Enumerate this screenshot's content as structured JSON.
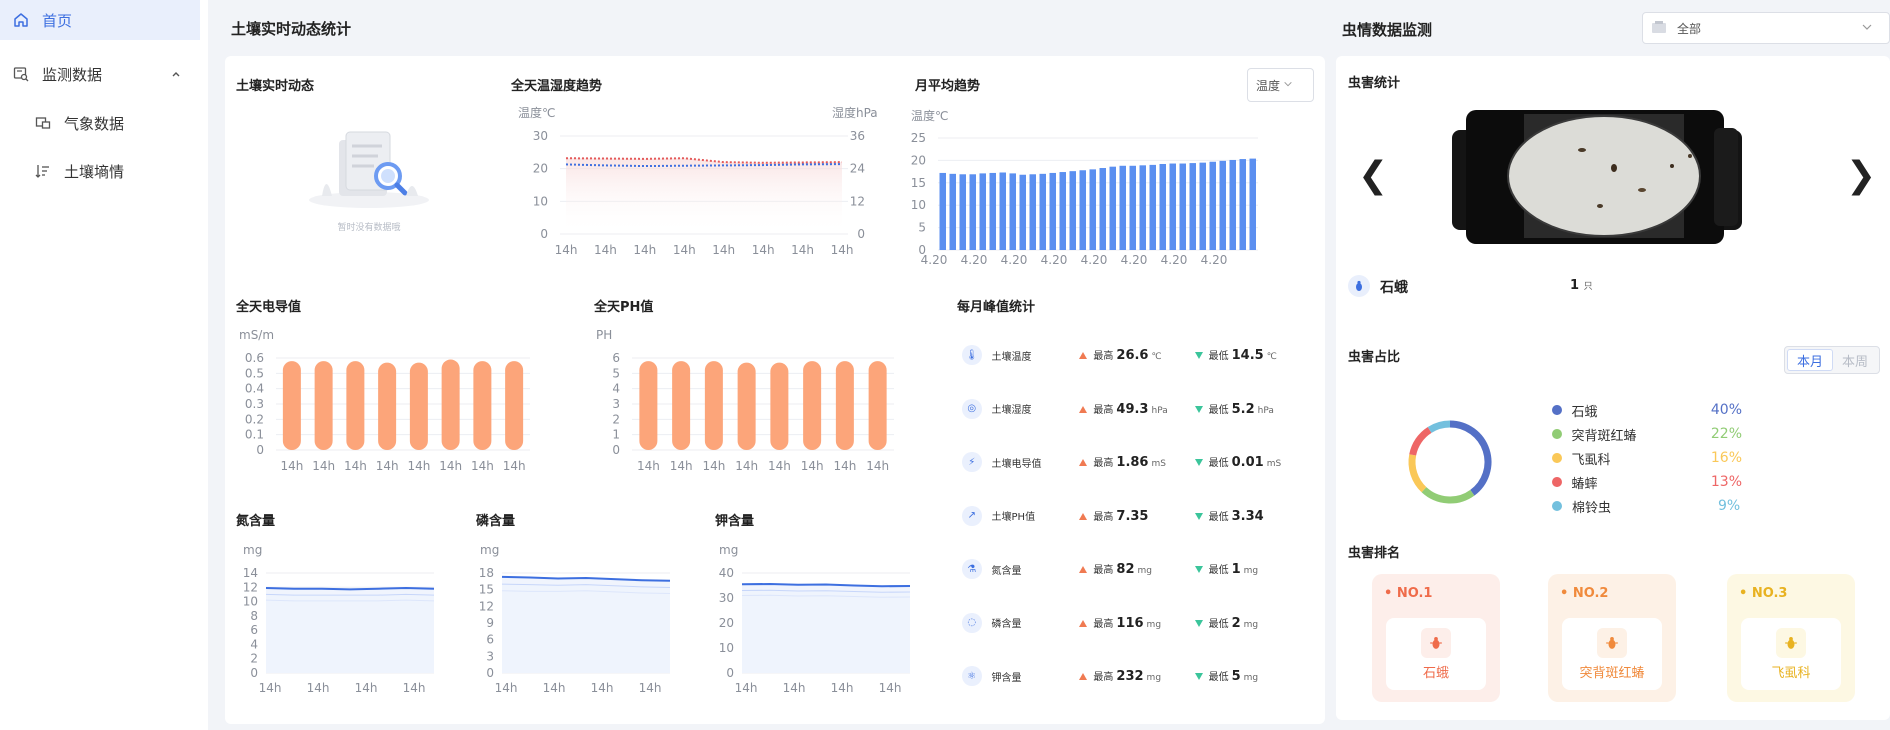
{
  "sidebar": {
    "items": [
      {
        "label": "首页"
      },
      {
        "label": "监测数据"
      },
      {
        "label": "气象数据"
      },
      {
        "label": "土壤墒情"
      }
    ]
  },
  "soil": {
    "title": "土壤实时动态统计",
    "realtime": {
      "title": "土壤实时动态",
      "empty": "暂时没有数据哦"
    },
    "temp_hum": {
      "title": "全天温湿度趋势",
      "ylabel_left": "温度℃",
      "ylabel_right": "湿度hPa"
    },
    "monthly": {
      "title": "月平均趋势",
      "select": "温度",
      "ylabel": "温度℃"
    },
    "ec": {
      "title": "全天电导值",
      "ylabel": "mS/m"
    },
    "ph": {
      "title": "全天PH值",
      "ylabel": "PH"
    },
    "n": {
      "title": "氮含量",
      "ylabel": "mg"
    },
    "p": {
      "title": "磷含量",
      "ylabel": "mg"
    },
    "k": {
      "title": "钾含量",
      "ylabel": "mg"
    },
    "peak": {
      "title": "每月峰值统计",
      "hi_label": "最高",
      "lo_label": "最低",
      "rows": [
        {
          "name": "土壤温度",
          "hi": "26.6",
          "hi_unit": "℃",
          "lo": "14.5",
          "lo_unit": "℃",
          "icon": "thermometer-icon"
        },
        {
          "name": "土壤湿度",
          "hi": "49.3",
          "hi_unit": "hPa",
          "lo": "5.2",
          "lo_unit": "hPa",
          "icon": "humidity-icon"
        },
        {
          "name": "土壤电导值",
          "hi": "1.86",
          "hi_unit": "mS",
          "lo": "0.01",
          "lo_unit": "mS",
          "icon": "lightning-icon"
        },
        {
          "name": "土壤PH值",
          "hi": "7.35",
          "hi_unit": "",
          "lo": "3.34",
          "lo_unit": "",
          "icon": "line-chart-icon"
        },
        {
          "name": "氮含量",
          "hi": "82",
          "hi_unit": "mg",
          "lo": "1",
          "lo_unit": "mg",
          "icon": "flask-icon"
        },
        {
          "name": "磷含量",
          "hi": "116",
          "hi_unit": "mg",
          "lo": "2",
          "lo_unit": "mg",
          "icon": "drop-icon"
        },
        {
          "name": "钾含量",
          "hi": "232",
          "hi_unit": "mg",
          "lo": "5",
          "lo_unit": "mg",
          "icon": "molecule-icon"
        }
      ]
    }
  },
  "pest": {
    "title": "虫情数据监测",
    "select": "全部",
    "stats": {
      "title": "虫害统计",
      "name": "石蛾",
      "count": "1",
      "count_unit": "只"
    },
    "ratio": {
      "title": "虫害占比",
      "toggle": [
        "本月",
        "本周"
      ],
      "items": [
        {
          "name": "石蛾",
          "pct": "40%",
          "color": "#5470c6"
        },
        {
          "name": "突背斑红蝽",
          "pct": "22%",
          "color": "#91cc75"
        },
        {
          "name": "飞虱科",
          "pct": "16%",
          "color": "#fac858"
        },
        {
          "name": "蝽蟀",
          "pct": "13%",
          "color": "#ee6666"
        },
        {
          "name": "棉铃虫",
          "pct": "9%",
          "color": "#73c0de"
        }
      ]
    },
    "rank": {
      "title": "虫害排名",
      "items": [
        {
          "no": "NO.1",
          "name": "石蛾",
          "bg": "#fdeeea",
          "fg": "#ef6b4a"
        },
        {
          "no": "NO.2",
          "name": "突背斑红蝽",
          "bg": "#fdf1e6",
          "fg": "#f08a3c"
        },
        {
          "no": "NO.3",
          "name": "飞虱科",
          "bg": "#fdf8e3",
          "fg": "#e8b221"
        }
      ]
    }
  },
  "chart_data": [
    {
      "id": "temp_hum",
      "type": "line",
      "x": [
        "14h",
        "14h",
        "14h",
        "14h",
        "14h",
        "14h",
        "14h",
        "14h"
      ],
      "yaxis_left": [
        0,
        10,
        20,
        30
      ],
      "yaxis_right": [
        0,
        12,
        24,
        36
      ],
      "series": [
        {
          "values": [
            23.2,
            23.1,
            23.0,
            23.2,
            22.0,
            21.8,
            21.9,
            22.0
          ],
          "color": "#e45a5a"
        },
        {
          "values": [
            21.3,
            21.0,
            20.8,
            20.9,
            21.0,
            21.1,
            21.3,
            21.4
          ],
          "color": "#3d6fe0"
        }
      ],
      "ylim": [
        0,
        30
      ]
    },
    {
      "id": "monthly",
      "type": "bar",
      "x_tick": "4.20",
      "yaxis": [
        0,
        5,
        10,
        15,
        20,
        25
      ],
      "ylim": [
        0,
        25
      ],
      "values": [
        17.2,
        17.0,
        16.9,
        16.9,
        17.1,
        17.2,
        17.3,
        17.1,
        16.8,
        16.9,
        17.0,
        17.2,
        17.4,
        17.6,
        17.8,
        18.0,
        18.3,
        18.6,
        18.8,
        18.8,
        18.9,
        19.0,
        19.2,
        19.3,
        19.3,
        19.4,
        19.5,
        19.7,
        19.9,
        20.1,
        20.3,
        20.4
      ],
      "color": "#5b8ff0"
    },
    {
      "id": "ec",
      "type": "bar",
      "x": [
        "14h",
        "14h",
        "14h",
        "14h",
        "14h",
        "14h",
        "14h",
        "14h"
      ],
      "yaxis": [
        "0",
        "0.1",
        "0.2",
        "0.3",
        "0.4",
        "0.5",
        "0.6"
      ],
      "ylim": [
        0,
        0.6
      ],
      "values": [
        0.58,
        0.58,
        0.58,
        0.57,
        0.57,
        0.59,
        0.58,
        0.58
      ],
      "color": "#fca57a"
    },
    {
      "id": "ph",
      "type": "bar",
      "x": [
        "14h",
        "14h",
        "14h",
        "14h",
        "14h",
        "14h",
        "14h",
        "14h"
      ],
      "yaxis": [
        "0",
        "1",
        "2",
        "3",
        "4",
        "5",
        "6"
      ],
      "ylim": [
        0,
        6
      ],
      "values": [
        5.8,
        5.8,
        5.8,
        5.7,
        5.7,
        5.8,
        5.8,
        5.8
      ],
      "color": "#fca57a"
    },
    {
      "id": "n",
      "type": "area",
      "x": [
        "14h",
        "14h",
        "14h",
        "14h"
      ],
      "yaxis": [
        "0",
        "2",
        "4",
        "6",
        "8",
        "10",
        "12",
        "14"
      ],
      "ylim": [
        0,
        14
      ],
      "series": [
        {
          "values": [
            11.9,
            11.8,
            11.8,
            11.7,
            11.8,
            11.9,
            11.8
          ],
          "color": "#3d6fe0"
        },
        {
          "values": [
            11.0,
            10.9,
            10.9,
            10.9,
            10.9,
            11.0,
            10.9
          ],
          "color": "#c7d6fa"
        },
        {
          "values": [
            10.2,
            10.1,
            10.1,
            10.1,
            10.1,
            10.2,
            10.1
          ],
          "color": "#dde6fb"
        }
      ]
    },
    {
      "id": "p",
      "type": "area",
      "x": [
        "14h",
        "14h",
        "14h",
        "14h"
      ],
      "yaxis": [
        "0",
        "3",
        "6",
        "9",
        "12",
        "15",
        "18"
      ],
      "ylim": [
        0,
        18
      ],
      "series": [
        {
          "values": [
            17.3,
            17.2,
            17.0,
            17.1,
            16.9,
            16.7,
            16.6
          ],
          "color": "#3d6fe0"
        },
        {
          "values": [
            16.0,
            15.9,
            15.8,
            15.9,
            15.7,
            15.5,
            15.4
          ],
          "color": "#c7d6fa"
        },
        {
          "values": [
            14.8,
            14.7,
            14.7,
            14.8,
            14.6,
            14.4,
            14.3
          ],
          "color": "#dde6fb"
        }
      ]
    },
    {
      "id": "k",
      "type": "area",
      "x": [
        "14h",
        "14h",
        "14h",
        "14h"
      ],
      "yaxis": [
        "0",
        "10",
        "20",
        "30",
        "40"
      ],
      "ylim": [
        0,
        40
      ],
      "series": [
        {
          "values": [
            35.5,
            35.6,
            35.3,
            35.4,
            35.0,
            34.7,
            34.8
          ],
          "color": "#3d6fe0"
        },
        {
          "values": [
            33.0,
            33.1,
            32.8,
            32.9,
            32.6,
            32.3,
            32.4
          ],
          "color": "#c7d6fa"
        },
        {
          "values": [
            31.0,
            31.1,
            30.8,
            30.9,
            30.6,
            30.3,
            30.4
          ],
          "color": "#dde6fb"
        }
      ]
    },
    {
      "id": "pest_ratio",
      "type": "pie",
      "labels": [
        "石蛾",
        "突背斑红蝽",
        "飞虱科",
        "蝽蟀",
        "棉铃虫"
      ],
      "values": [
        40,
        22,
        16,
        13,
        9
      ],
      "colors": [
        "#5470c6",
        "#91cc75",
        "#fac858",
        "#ee6666",
        "#73c0de"
      ]
    }
  ]
}
